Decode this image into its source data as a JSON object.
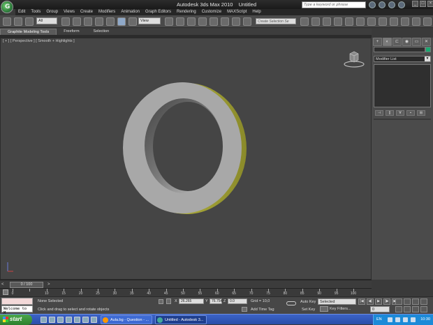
{
  "window": {
    "title_app": "Autodesk 3ds Max  2010",
    "title_doc": "Untitled",
    "search_placeholder": "Type a keyword or phrase",
    "logo_letter": "G"
  },
  "menu": [
    "Edit",
    "Tools",
    "Group",
    "Views",
    "Create",
    "Modifiers",
    "Animation",
    "Graph Editors",
    "Rendering",
    "Customize",
    "MAXScript",
    "Help"
  ],
  "toolbar": {
    "filter_value": "All",
    "coord_value": "View",
    "selection_set_placeholder": "Create Selection Se"
  },
  "ribbon": {
    "tabs": [
      "Graphite Modeling Tools",
      "Freeform",
      "Selection"
    ]
  },
  "viewport": {
    "label": "[ + ] [ Perspective ] [ Smooth + Highlights ]",
    "object_color": "#a8a8a8",
    "object_edge_color": "#b9b84a"
  },
  "command_panel": {
    "tabs": [
      "+",
      "◐",
      "⊏",
      "◉",
      "▭",
      "✕"
    ],
    "modifier_list": "Modifier List",
    "stack_tools": [
      "⊣",
      "||",
      "∀",
      "▪",
      "⊞"
    ],
    "object_color": "#1aa870"
  },
  "timeline": {
    "frame_display": "0 / 100",
    "tick_labels": [
      "0",
      "10",
      "15",
      "20",
      "25",
      "30",
      "35",
      "40",
      "45",
      "50",
      "55",
      "60",
      "65",
      "70",
      "75",
      "80",
      "85",
      "90",
      "95",
      "100"
    ]
  },
  "status": {
    "maxscript_text": "Welcome to M",
    "selection": "None Selected",
    "prompt": "Click and drag to select and rotate objects",
    "x_label": "X",
    "x_value": "26.265",
    "y_label": "Y",
    "y_value": "76.754",
    "z_label": "Z",
    "z_value": "0.0",
    "grid": "Grid = 10,0",
    "add_time_tag": "Add Time Tag",
    "auto_key": "Auto Key",
    "set_key": "Set Key",
    "selected_value": "Selected",
    "key_filters": "Key Filters...",
    "frame_value": "0"
  },
  "taskbar": {
    "start_label": "start",
    "tasks": [
      "Aula.bg - Question - ...",
      "Untitled - Autodesk 3..."
    ],
    "lang": "EN",
    "clock": "10:30"
  }
}
